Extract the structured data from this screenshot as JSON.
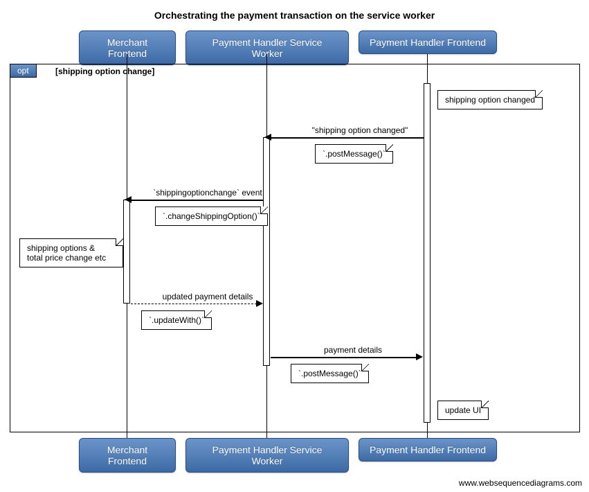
{
  "title": "Orchestrating the payment transaction on the service worker",
  "participants": {
    "p1": "Merchant Frontend",
    "p2": "Payment Handler Service Worker",
    "p3": "Payment Handler Frontend"
  },
  "opt": {
    "tag": "opt",
    "guard": "[shipping option change]"
  },
  "notes": {
    "n1": "shipping option changed",
    "n2": "`.postMessage()`",
    "n3": "`.changeShippingOption()`",
    "n4_line1": "shipping options &",
    "n4_line2": "total price change etc",
    "n5": "`.updateWith()`",
    "n6": "`.postMessage()`",
    "n7": "update UI"
  },
  "messages": {
    "m1": "\"shipping option changed\"",
    "m2": "`shippingoptionchange` event",
    "m3": "updated payment details",
    "m4": "payment details"
  },
  "footer": "www.websequencediagrams.com",
  "chart_data": {
    "type": "sequence-diagram",
    "title": "Orchestrating the payment transaction on the service worker",
    "participants": [
      "Merchant Frontend",
      "Payment Handler Service Worker",
      "Payment Handler Frontend"
    ],
    "fragments": [
      {
        "type": "opt",
        "guard": "shipping option change",
        "steps": [
          {
            "type": "note",
            "over": "Payment Handler Frontend",
            "text": "shipping option changed"
          },
          {
            "type": "message",
            "from": "Payment Handler Frontend",
            "to": "Payment Handler Service Worker",
            "label": "\"shipping option changed\"",
            "note": ".postMessage()"
          },
          {
            "type": "message",
            "from": "Payment Handler Service Worker",
            "to": "Merchant Frontend",
            "label": "`shippingoptionchange` event",
            "note": ".changeShippingOption()"
          },
          {
            "type": "note",
            "over": "Merchant Frontend",
            "text": "shipping options & total price change etc"
          },
          {
            "type": "return",
            "from": "Merchant Frontend",
            "to": "Payment Handler Service Worker",
            "label": "updated payment details",
            "note": ".updateWith()"
          },
          {
            "type": "message",
            "from": "Payment Handler Service Worker",
            "to": "Payment Handler Frontend",
            "label": "payment details",
            "note": ".postMessage()"
          },
          {
            "type": "note",
            "over": "Payment Handler Frontend",
            "text": "update UI"
          }
        ]
      }
    ]
  }
}
